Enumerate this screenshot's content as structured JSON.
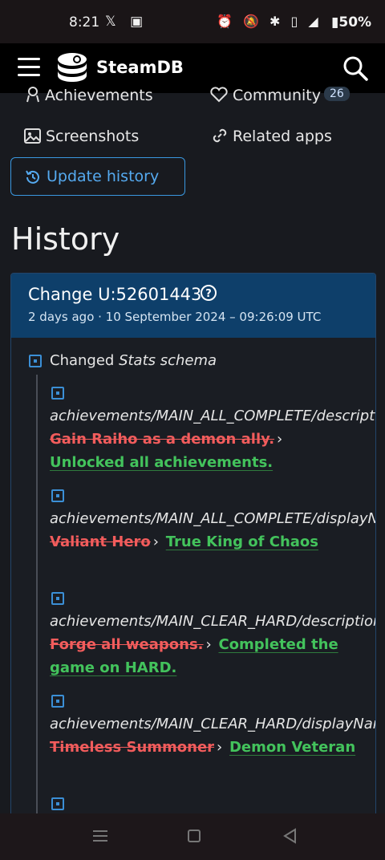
{
  "status_bar": {
    "time": "8:21",
    "battery": "50%"
  },
  "header": {
    "brand": "SteamDB"
  },
  "nav_links": {
    "achievements": "Achievements",
    "community": "Community",
    "community_count": "26",
    "screenshots": "Screenshots",
    "related_apps": "Related apps",
    "update_history": "Update history"
  },
  "page": {
    "title": "History"
  },
  "change": {
    "id": "Change U:52601443",
    "date": "2 days ago · 10 September 2024 – 09:26:09 UTC",
    "changed_prefix": "Changed",
    "changed_subject": "Stats schema",
    "entries": [
      {
        "key": "achievements/MAIN_ALL_COMPLETE/description:",
        "old": "Gain Raiho as a demon ally.",
        "new": "Unlocked all achievements."
      },
      {
        "key": "achievements/MAIN_ALL_COMPLETE/displayName:",
        "old": "Valiant Hero",
        "new": "True King of Chaos"
      },
      {
        "key": "achievements/MAIN_CLEAR_HARD/description:",
        "old": "Forge all weapons.",
        "new": "Completed the game on HARD."
      },
      {
        "key": "achievements/MAIN_CLEAR_HARD/displayName:",
        "old": "Timeless Summoner",
        "new": "Demon Veteran"
      }
    ],
    "arrow": "›"
  },
  "colors": {
    "accent_blue": "#3b8fd6",
    "removed_red": "#f25c5c",
    "added_green": "#43c35c",
    "header_bg": "#0e3f6a"
  },
  "icons": [
    "menu-icon",
    "steamdb-logo-icon",
    "search-icon",
    "achievement-icon",
    "heart-icon",
    "image-icon",
    "link-icon",
    "history-icon",
    "help-icon",
    "diff-box-icon"
  ]
}
